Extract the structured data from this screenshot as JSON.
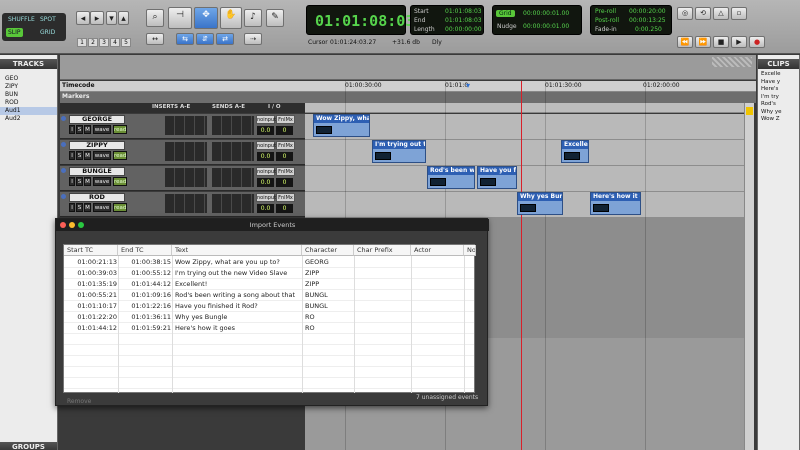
{
  "toolbar": {
    "modes": [
      "SHUFFLE",
      "SPOT",
      "SLIP",
      "GRID"
    ],
    "number_buttons": [
      "1",
      "2",
      "3",
      "4",
      "5"
    ],
    "main_counter": "01:01:08:03",
    "start_label": "Start",
    "start_value": "01:01:08:03",
    "end_label": "End",
    "end_value": "01:01:08:03",
    "length_label": "Length",
    "length_value": "00:00:00:00",
    "cursor_label": "Cursor",
    "cursor_value": "01:01:24:03.27",
    "level_value": "+31.6 db",
    "dly_label": "Dly",
    "grid_label": "Grid",
    "grid_value": "00:00:00:01.00",
    "nudge_label": "Nudge",
    "nudge_value": "00:00:00:01.00",
    "preroll_label": "Pre-roll",
    "preroll_value": "00:00:20:00",
    "postroll_label": "Post-roll",
    "postroll_value": "00:00:13:25",
    "fadein_label": "Fade-in",
    "fadein_value": "0:00.250"
  },
  "tracks_panel": {
    "title": "TRACKS",
    "items": [
      "GEO",
      "ZIPY",
      "BUN",
      "ROD",
      "Aud1",
      "Aud2"
    ]
  },
  "clips_panel": {
    "title": "CLIPS",
    "items": [
      "Excelle",
      "Have y",
      "Here's",
      "I'm try",
      "Rod's",
      "Why ye",
      "Wow Z"
    ]
  },
  "groups_panel": {
    "title": "GROUPS"
  },
  "rulers": {
    "timecode_label": "Timecode",
    "markers_label": "Markers",
    "ticks": [
      "01:00:30:00",
      "01:01:0",
      "01:01:30:00",
      "01:02:00:00"
    ]
  },
  "mix_columns": {
    "inserts": "INSERTS A-E",
    "sends": "SENDS A-E",
    "io": "I / O"
  },
  "tracks": [
    {
      "name": "GEORGE",
      "input": "noinput",
      "output": "FnlMx",
      "volume": "0.0",
      "pan": "0"
    },
    {
      "name": "ZIPPY",
      "input": "noinput",
      "output": "FnlMx",
      "volume": "0.0",
      "pan": "0"
    },
    {
      "name": "BUNGLE",
      "input": "noinput",
      "output": "FnlMx",
      "volume": "0.0",
      "pan": "0"
    },
    {
      "name": "ROD",
      "input": "noinput",
      "output": "FnlMx",
      "volume": "0.0",
      "pan": "0"
    }
  ],
  "track_controls": {
    "i": "I",
    "s": "S",
    "m": "M",
    "wave": "wave",
    "read": "read"
  },
  "clips": [
    {
      "title": "Wow Zippy, what ar"
    },
    {
      "title": "I'm trying out the n"
    },
    {
      "title": "Excellent"
    },
    {
      "title": "Rod's been writ"
    },
    {
      "title": "Have you fini"
    },
    {
      "title": "Why yes Bungl"
    },
    {
      "title": "Here's how it goe"
    }
  ],
  "dialog": {
    "title": "Import Events",
    "columns": [
      "Start TC",
      "End TC",
      "Text",
      "Character",
      "Char Prefix",
      "Actor",
      "Not"
    ],
    "rows": [
      [
        "01:00:21:13",
        "01:00:38:15",
        "Wow Zippy, what are you up to?",
        "GEORG"
      ],
      [
        "01:00:39:03",
        "01:00:55:12",
        "I'm trying out the new Video Slave",
        "ZIPP"
      ],
      [
        "01:01:35:19",
        "01:01:44:12",
        "Excellent!",
        "ZIPP"
      ],
      [
        "01:00:55:21",
        "01:01:09:16",
        "Rod's been writing a song about that",
        "BUNGL"
      ],
      [
        "01:01:10:17",
        "01:01:22:16",
        "Have you finished it Rod?",
        "BUNGL"
      ],
      [
        "01:01:22:20",
        "01:01:36:11",
        "Why yes Bungle",
        "RO"
      ],
      [
        "01:01:44:12",
        "01:01:59:21",
        "Here's how it goes",
        "RO"
      ]
    ],
    "footer_left": "Remove",
    "footer_right": "7 unassigned events"
  },
  "colors": {
    "counter_green": "#56d44c",
    "clip_blue": "#7ea3d6",
    "clip_title": "#2d5fb3",
    "playhead": "#d8202a",
    "selected_tool": "#3a74c9"
  }
}
